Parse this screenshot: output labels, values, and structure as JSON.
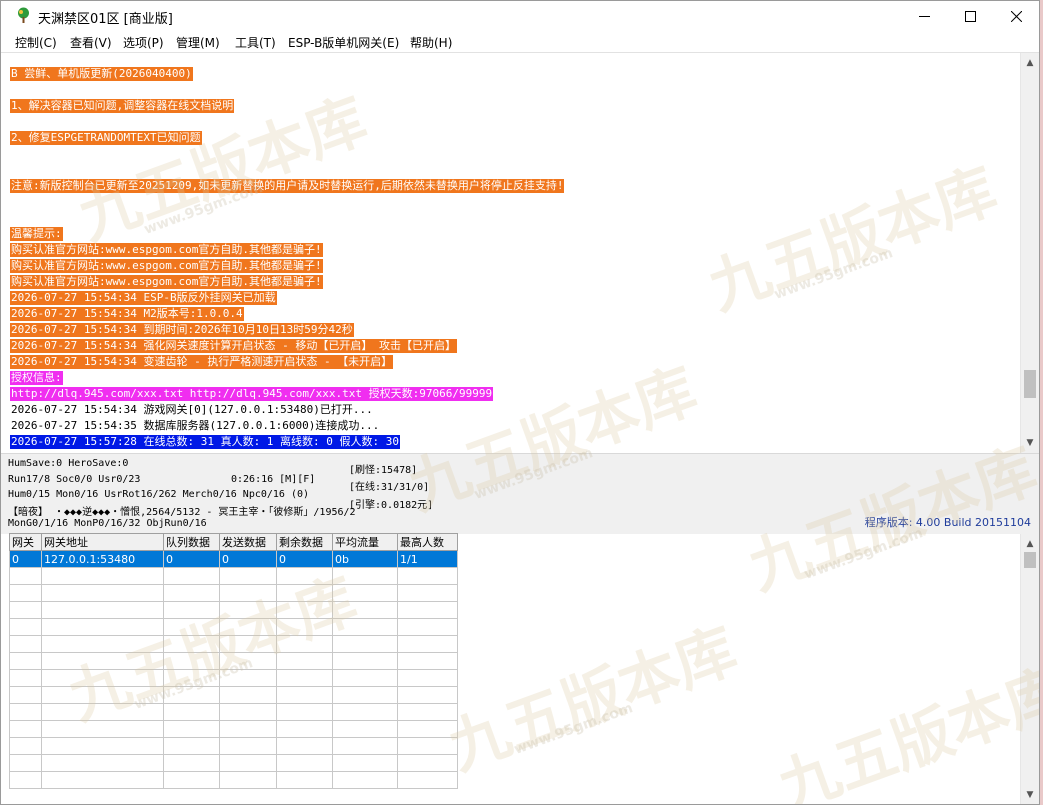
{
  "window": {
    "title": "天渊禁区01区 [商业版]"
  },
  "menubar": [
    "控制(C)",
    "查看(V)",
    "选项(P)",
    "管理(M)",
    "工具(T)",
    "ESP-B版单机网关(E)",
    "帮助(H)"
  ],
  "log_lines": [
    {
      "text": "B 尝鲜、单机版更新(2026040400)",
      "style": "orange"
    },
    {
      "text": "1、解决容器已知问题,调整容器在线文档说明",
      "style": "orange"
    },
    {
      "text": "2、修复ESPGETRANDOMTEXT已知问题",
      "style": "orange"
    },
    {
      "text": "注意:新版控制台已更新至20251209,如未更新替换的用户请及时替换运行,后期依然未替换用户将停止反挂支持!",
      "style": "orange"
    },
    {
      "text": "温馨提示:",
      "style": "orange"
    },
    {
      "text": "购买认准官方网站:www.espgom.com官方自助.其他都是骗子!",
      "style": "orange"
    },
    {
      "text": "购买认准官方网站:www.espgom.com官方自助.其他都是骗子!",
      "style": "orange"
    },
    {
      "text": "购买认准官方网站:www.espgom.com官方自助.其他都是骗子!",
      "style": "orange"
    },
    {
      "text": "2026-07-27 15:54:34 ESP-B版反外挂网关已加载",
      "style": "orange"
    },
    {
      "text": "2026-07-27 15:54:34 M2版本号:1.0.0.4",
      "style": "orange"
    },
    {
      "text": "2026-07-27 15:54:34 到期时间:2026年10月10日13时59分42秒",
      "style": "orange"
    },
    {
      "text": "2026-07-27 15:54:34 强化网关速度计算开启状态 - 移动【已开启】 攻击【已开启】",
      "style": "orange"
    },
    {
      "text": "2026-07-27 15:54:34 变速齿轮 - 执行严格测速开启状态 - 【未开启】",
      "style": "orange"
    },
    {
      "text": "授权信息:",
      "style": "magenta"
    },
    {
      "text": "http://dlq.945.com/xxx.txt http://dlq.945.com/xxx.txt 授权天数:97066/99999",
      "style": "magenta"
    },
    {
      "text": "2026-07-27 15:54:34 游戏网关[0](127.0.0.1:53480)已打开...",
      "style": "plain"
    },
    {
      "text": "2026-07-27 15:54:35 数据库服务器(127.0.0.1:6000)连接成功...",
      "style": "plain"
    },
    {
      "text": "2026-07-27 15:57:28 在线总数: 31 真人数: 1 离线数: 0 假人数: 30",
      "style": "blue"
    }
  ],
  "status": {
    "humsave": "HumSave:0 HeroSave:0",
    "run": "Run17/8 Soc0/0 Usr0/23",
    "time": "0:26:16 [M][F]",
    "hum": "Hum0/15 Mon0/16 UsrRot16/262 Merch0/16 Npc0/16 (0)",
    "chat": "【暗夜】 ・◆◆◆逆◆◆◆・憎恨,2564/5132 - 冥王主宰・「彼修斯」/1956/2",
    "mong": "MonG0/1/16 MonP0/16/32 ObjRun0/16",
    "refresh": "[刷怪:15478]",
    "online": "[在线:31/31/0]",
    "gold": "[引擎:0.0182元]",
    "version": "程序版本: 4.00 Build 20151104"
  },
  "gateway_table": {
    "headers": [
      "网关",
      "网关地址",
      "队列数据",
      "发送数据",
      "剩余数据",
      "平均流量",
      "最高人数"
    ],
    "rows": [
      [
        "0",
        "127.0.0.1:53480",
        "0",
        "0",
        "0",
        "0b",
        "1/1"
      ]
    ]
  },
  "watermark": {
    "text": "九五版本库",
    "sub": "www.95gm.com"
  },
  "colors": {
    "log_orange": "#f0761d",
    "log_magenta": "#f02ef0",
    "log_blue": "#0019e6",
    "selection": "#0078d7"
  }
}
